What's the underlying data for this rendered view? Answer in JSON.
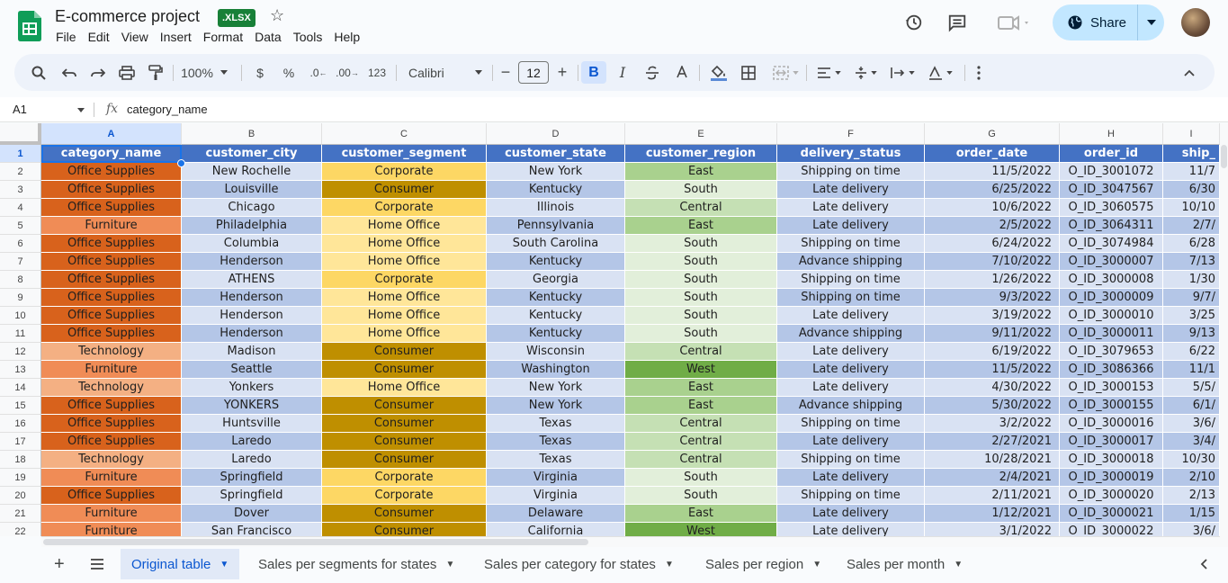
{
  "doc": {
    "title": "E-commerce project",
    "badge": ".XLSX"
  },
  "menu": [
    "File",
    "Edit",
    "View",
    "Insert",
    "Format",
    "Data",
    "Tools",
    "Help"
  ],
  "share": {
    "label": "Share"
  },
  "toolbar": {
    "zoom": "100%",
    "currency": "$",
    "percent": "%",
    "dec_decrease": ".0",
    "dec_increase": ".00",
    "number_format": "123",
    "font": "Calibri",
    "font_size": "12",
    "bold": "B",
    "italic": "I"
  },
  "formula": {
    "cell_ref": "A1",
    "fx": "fx",
    "content": "category_name"
  },
  "grid": {
    "columns": [
      {
        "letter": "A",
        "width": 156
      },
      {
        "letter": "B",
        "width": 156
      },
      {
        "letter": "C",
        "width": 183
      },
      {
        "letter": "D",
        "width": 154
      },
      {
        "letter": "E",
        "width": 169
      },
      {
        "letter": "F",
        "width": 164
      },
      {
        "letter": "G",
        "width": 150
      },
      {
        "letter": "H",
        "width": 115
      },
      {
        "letter": "I",
        "width": 63
      }
    ],
    "headers": [
      "category_name",
      "customer_city",
      "customer_segment",
      "customer_state",
      "customer_region",
      "delivery_status",
      "order_date",
      "order_id",
      "ship_"
    ],
    "rows": [
      [
        "Office Supplies",
        "New Rochelle",
        "Corporate",
        "New York",
        "East",
        "Shipping on time",
        "11/5/2022",
        "O_ID_3001072",
        "11/7"
      ],
      [
        "Office Supplies",
        "Louisville",
        "Consumer",
        "Kentucky",
        "South",
        "Late delivery",
        "6/25/2022",
        "O_ID_3047567",
        "6/30"
      ],
      [
        "Office Supplies",
        "Chicago",
        "Corporate",
        "Illinois",
        "Central",
        "Late delivery",
        "10/6/2022",
        "O_ID_3060575",
        "10/10"
      ],
      [
        "Furniture",
        "Philadelphia",
        "Home Office",
        "Pennsylvania",
        "East",
        "Late delivery",
        "2/5/2022",
        "O_ID_3064311",
        "2/7/"
      ],
      [
        "Office Supplies",
        "Columbia",
        "Home Office",
        "South Carolina",
        "South",
        "Shipping on time",
        "6/24/2022",
        "O_ID_3074984",
        "6/28"
      ],
      [
        "Office Supplies",
        "Henderson",
        "Home Office",
        "Kentucky",
        "South",
        "Advance shipping",
        "7/10/2022",
        "O_ID_3000007",
        "7/13"
      ],
      [
        "Office Supplies",
        "ATHENS",
        "Corporate",
        "Georgia",
        "South",
        "Shipping on time",
        "1/26/2022",
        "O_ID_3000008",
        "1/30"
      ],
      [
        "Office Supplies",
        "Henderson",
        "Home Office",
        "Kentucky",
        "South",
        "Shipping on time",
        "9/3/2022",
        "O_ID_3000009",
        "9/7/"
      ],
      [
        "Office Supplies",
        "Henderson",
        "Home Office",
        "Kentucky",
        "South",
        "Late delivery",
        "3/19/2022",
        "O_ID_3000010",
        "3/25"
      ],
      [
        "Office Supplies",
        "Henderson",
        "Home Office",
        "Kentucky",
        "South",
        "Advance shipping",
        "9/11/2022",
        "O_ID_3000011",
        "9/13"
      ],
      [
        "Technology",
        "Madison",
        "Consumer",
        "Wisconsin",
        "Central",
        "Late delivery",
        "6/19/2022",
        "O_ID_3079653",
        "6/22"
      ],
      [
        "Furniture",
        "Seattle",
        "Consumer",
        "Washington",
        "West",
        "Late delivery",
        "11/5/2022",
        "O_ID_3086366",
        "11/1"
      ],
      [
        "Technology",
        "Yonkers",
        "Home Office",
        "New York",
        "East",
        "Late delivery",
        "4/30/2022",
        "O_ID_3000153",
        "5/5/"
      ],
      [
        "Office Supplies",
        "YONKERS",
        "Consumer",
        "New York",
        "East",
        "Advance shipping",
        "5/30/2022",
        "O_ID_3000155",
        "6/1/"
      ],
      [
        "Office Supplies",
        "Huntsville",
        "Consumer",
        "Texas",
        "Central",
        "Shipping on time",
        "3/2/2022",
        "O_ID_3000016",
        "3/6/"
      ],
      [
        "Office Supplies",
        "Laredo",
        "Consumer",
        "Texas",
        "Central",
        "Late delivery",
        "2/27/2021",
        "O_ID_3000017",
        "3/4/"
      ],
      [
        "Technology",
        "Laredo",
        "Consumer",
        "Texas",
        "Central",
        "Shipping on time",
        "10/28/2021",
        "O_ID_3000018",
        "10/30"
      ],
      [
        "Furniture",
        "Springfield",
        "Corporate",
        "Virginia",
        "South",
        "Late delivery",
        "2/4/2021",
        "O_ID_3000019",
        "2/10"
      ],
      [
        "Office Supplies",
        "Springfield",
        "Corporate",
        "Virginia",
        "South",
        "Shipping on time",
        "2/11/2021",
        "O_ID_3000020",
        "2/13"
      ],
      [
        "Furniture",
        "Dover",
        "Consumer",
        "Delaware",
        "East",
        "Late delivery",
        "1/12/2021",
        "O_ID_3000021",
        "1/15"
      ],
      [
        "Furniture",
        "San Francisco",
        "Consumer",
        "California",
        "West",
        "Late delivery",
        "3/1/2022",
        "O_ID_3000022",
        "3/6/"
      ]
    ]
  },
  "colors": {
    "header_fill": "#4472c4",
    "category": {
      "Office Supplies": "#d8621c",
      "Furniture": "#f08c56",
      "Technology": "#f4b083"
    },
    "segment": {
      "Corporate": "#fdd764",
      "Consumer": "#bf8f00",
      "Home Office": "#ffe699"
    },
    "region": {
      "East": "#a9d18e",
      "South": "#e2efda",
      "Central": "#c5e0b4",
      "West": "#70ad47"
    },
    "blue_light": "#d9e2f3",
    "blue_mid": "#b4c6e7"
  },
  "tabs": [
    {
      "label": "Original table",
      "active": true
    },
    {
      "label": "Sales per segments for states",
      "active": false
    },
    {
      "label": "Sales per category for states",
      "active": false
    },
    {
      "label": "Sales per region",
      "active": false
    },
    {
      "label": "Sales per month",
      "active": false
    }
  ]
}
